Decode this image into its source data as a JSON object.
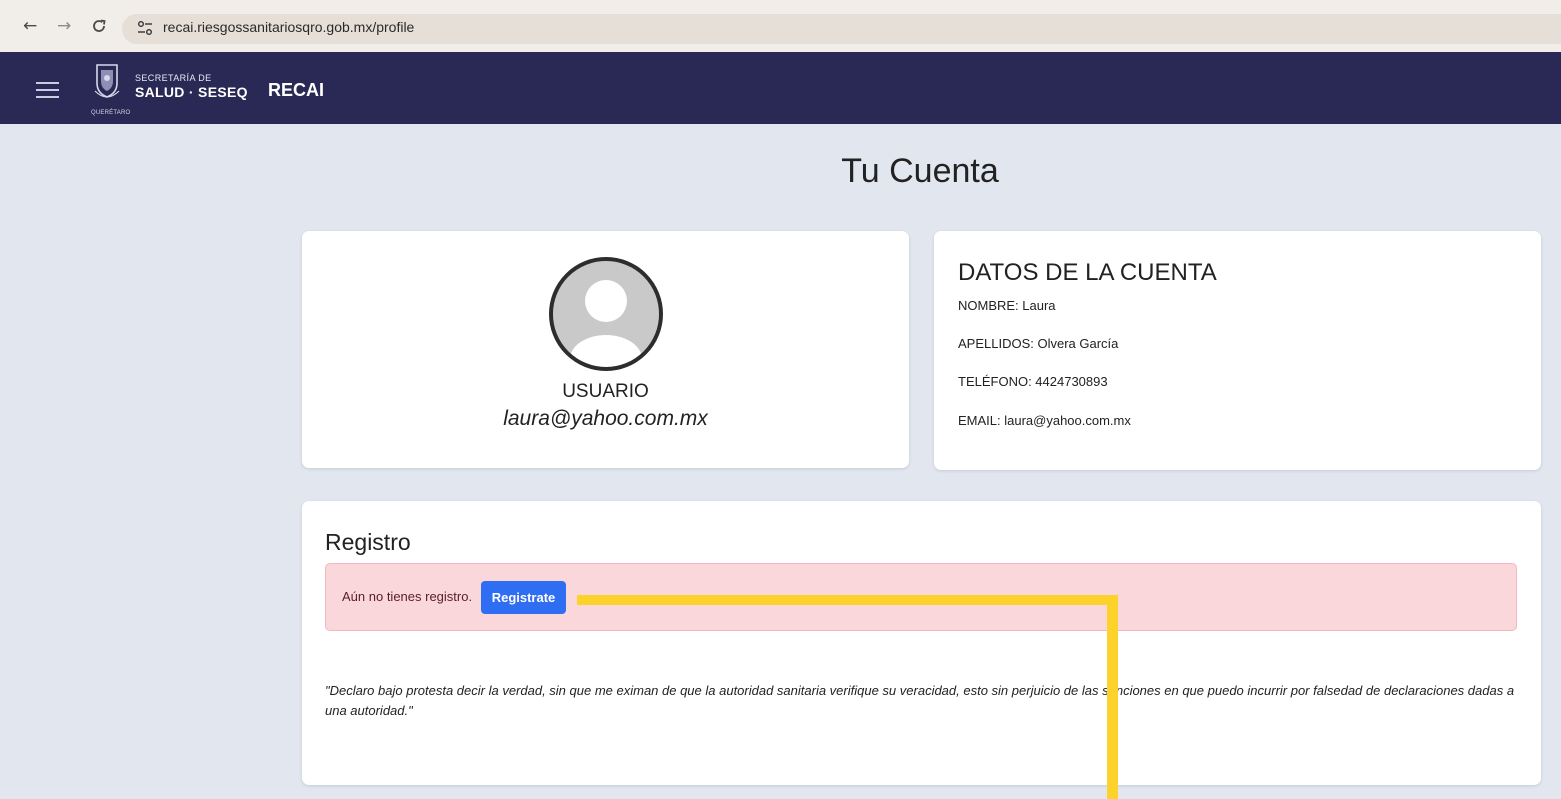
{
  "browser": {
    "url": "recai.riesgossanitariosqro.gob.mx/profile",
    "back_icon": "arrow-left-icon",
    "forward_icon": "arrow-right-icon",
    "reload_icon": "reload-icon",
    "site_info_icon": "site-settings-icon"
  },
  "header": {
    "brand_top": "SECRETARÍA DE",
    "brand_main": "SALUD · SESEQ",
    "seal_caption": "QUERÉTARO",
    "app_title": "RECAI",
    "menu_icon": "hamburger-menu-icon",
    "bg_color": "#2a2955"
  },
  "page": {
    "title": "Tu Cuenta"
  },
  "profile": {
    "label": "USUARIO",
    "email": "laura@yahoo.com.mx",
    "avatar_icon": "user-avatar-icon"
  },
  "account": {
    "title": "DATOS DE LA CUENTA",
    "nombre": "NOMBRE: Laura",
    "apellidos": "APELLIDOS: Olvera García",
    "telefono": "TELÉFONO: 4424730893",
    "email": "EMAIL: laura@yahoo.com.mx"
  },
  "registro": {
    "title": "Registro",
    "alert_text": "Aún no tienes registro.",
    "button_label": "Registrate",
    "alert_color": "#f9d7db",
    "button_color": "#2f6ef2",
    "declaration": "\"Declaro bajo protesta decir la verdad, sin que me eximan de que la autoridad sanitaria verifique su veracidad, esto sin perjuicio de las sanciones en que puedo incurrir por falsedad de declaraciones dadas a una autoridad.\""
  },
  "annotation_color": "#fdd22b"
}
